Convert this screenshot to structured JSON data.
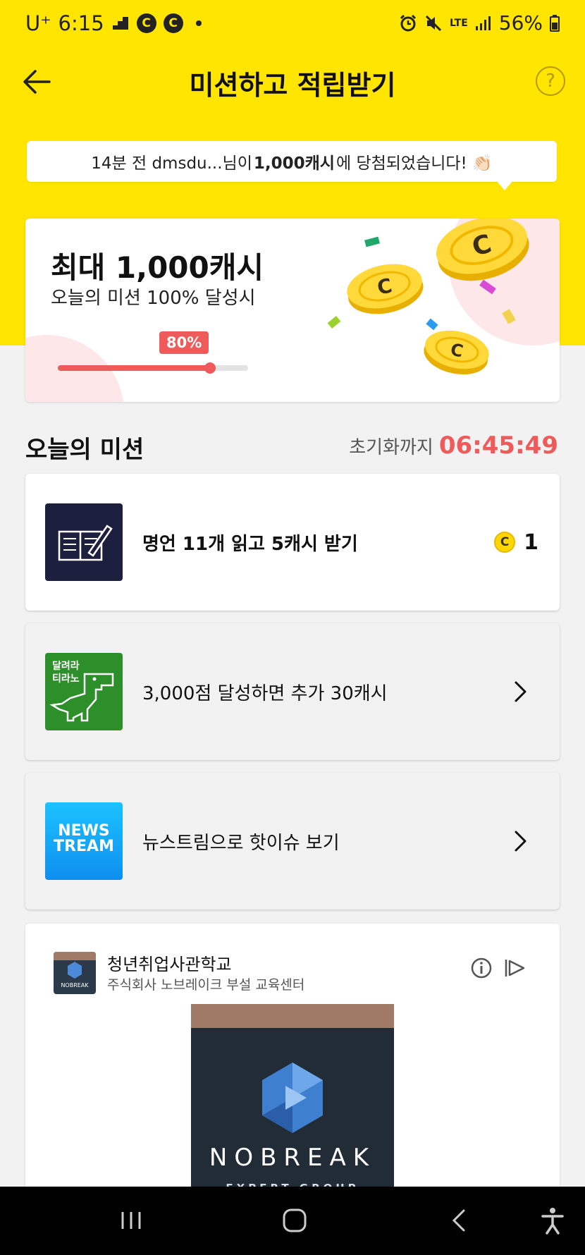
{
  "status_bar": {
    "carrier": "U⁺",
    "time": "6:15",
    "badge1": "C",
    "badge2": "C",
    "network": "LTE",
    "battery": "56%"
  },
  "header": {
    "title": "미션하고 적립받기"
  },
  "notice": {
    "prefix": "14분 전 dmsdu...님이",
    "amount": "1,000캐시",
    "suffix": "에 당첨되었습니다! 👏🏻"
  },
  "reward_card": {
    "title": "최대 1,000캐시",
    "subtitle": "오늘의 미션 100% 달성시",
    "progress_label": "80%",
    "progress_value": 0.8,
    "coin_letter": "C"
  },
  "missions_section": {
    "title": "오늘의 미션",
    "reset_label": "초기화까지",
    "reset_time": "06:45:49"
  },
  "missions": [
    {
      "label": "명언 11개 읽고 5캐시 받기",
      "reward_icon": "C",
      "reward_value": "1",
      "icon": "book-quill-icon"
    },
    {
      "label": "3,000점 달성하면 추가 30캐시",
      "icon_text_line1": "달려라",
      "icon_text_line2": "티라노",
      "icon": "dinosaur-icon"
    },
    {
      "label": "뉴스트림으로 핫이슈 보기",
      "icon_text_line1": "NEWS",
      "icon_text_line2": "TREAM",
      "icon": "newstream-icon"
    }
  ],
  "ad": {
    "advertiser": "청년취업사관학교",
    "description": "주식회사 노브레이크 부설 교육센터",
    "brand": "NOBREAK",
    "brand_sub": "EXPERT GROUP",
    "logo_text": "NOBREAK"
  },
  "colors": {
    "yellow": "#ffe500",
    "accent_red": "#ef5a5a",
    "dino_green": "#2d8f2a",
    "news_blue": "#1aa7f5"
  }
}
